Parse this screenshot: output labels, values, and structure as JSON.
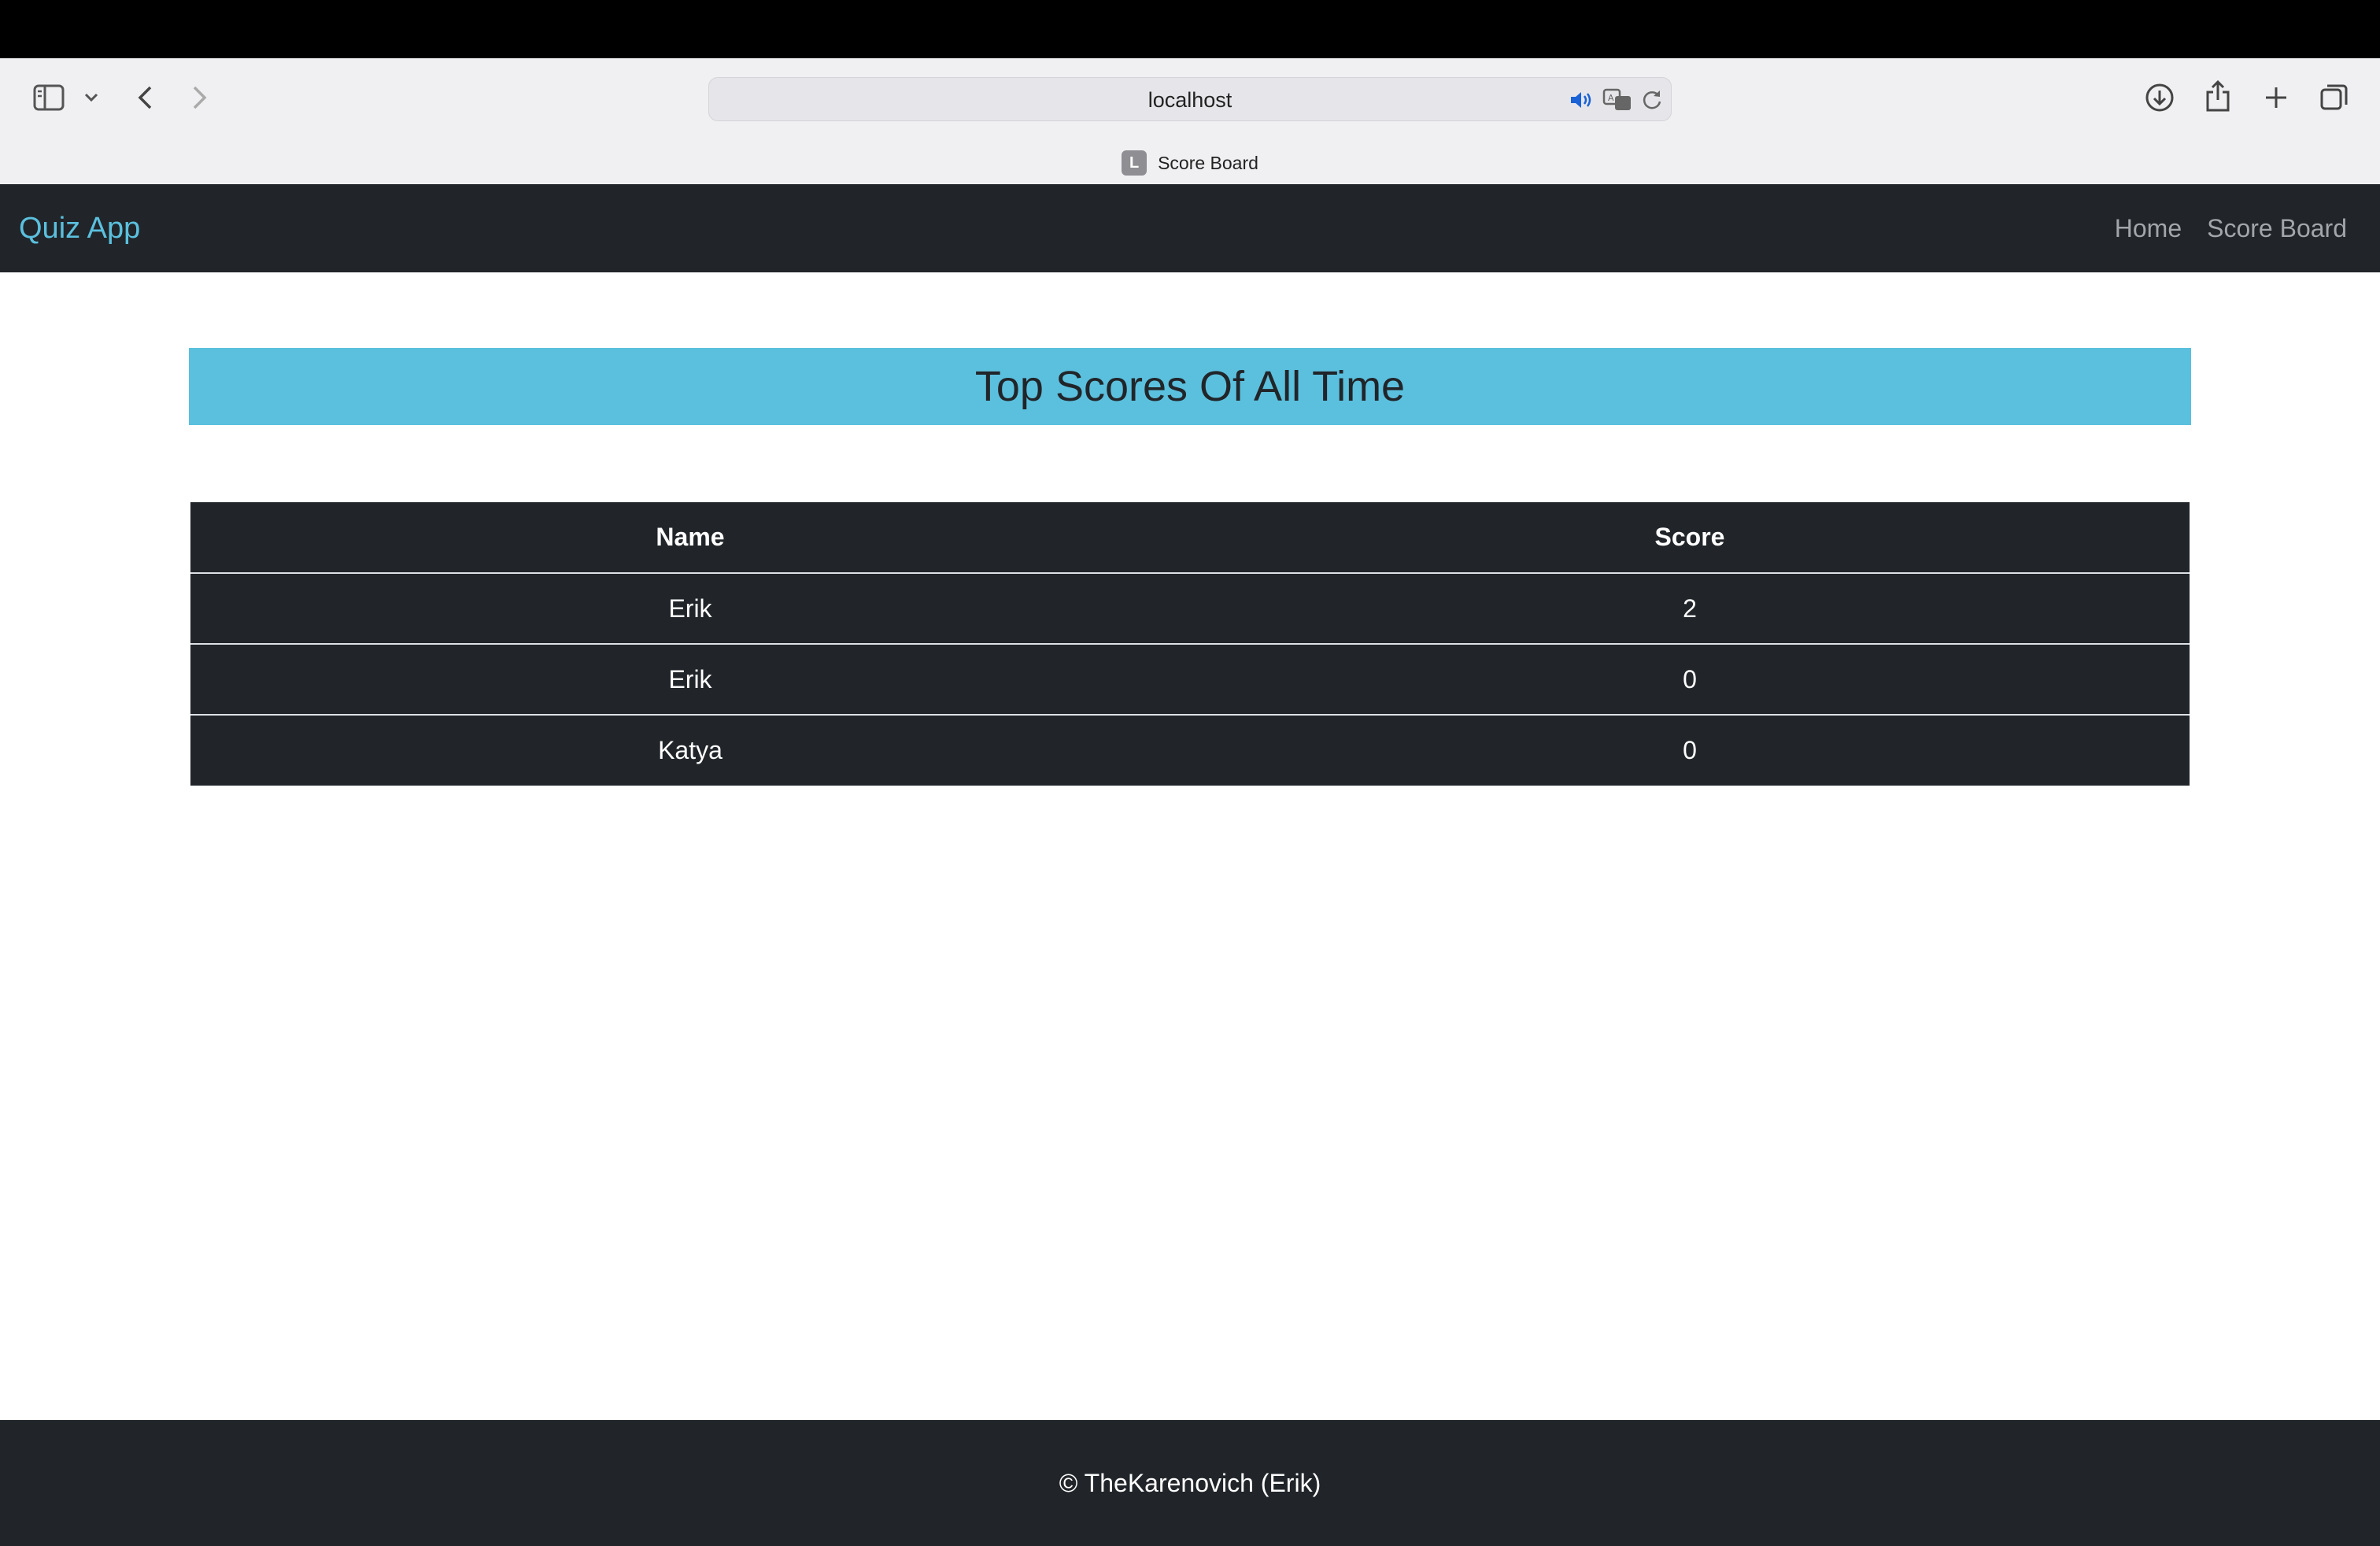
{
  "browser": {
    "url": "localhost",
    "tab": {
      "favicon_letter": "L",
      "title": "Score Board"
    },
    "icons": [
      "sidebar-icon",
      "chevron-down-icon",
      "back-icon",
      "forward-icon",
      "speaker-icon",
      "translate-icon",
      "reload-icon",
      "download-icon",
      "share-icon",
      "new-tab-icon",
      "tab-overview-icon"
    ]
  },
  "navbar": {
    "brand": "Quiz App",
    "links": [
      "Home",
      "Score Board"
    ],
    "brand_color": "#5bc0de",
    "bg_color": "#212529"
  },
  "banner": {
    "title": "Top Scores Of All Time",
    "color": "#5bc0de"
  },
  "table": {
    "headers": [
      "Name",
      "Score"
    ],
    "rows": [
      [
        "Erik",
        "2"
      ],
      [
        "Erik",
        "0"
      ],
      [
        "Katya",
        "0"
      ]
    ]
  },
  "footer": {
    "text": "© TheKarenovich (Erik)"
  }
}
